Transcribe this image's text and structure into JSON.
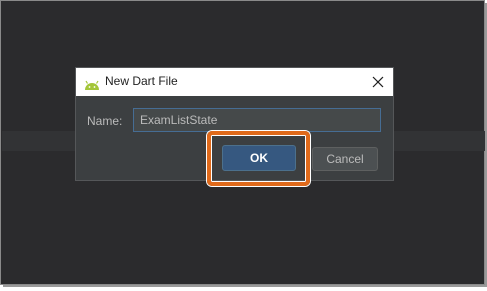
{
  "dialog": {
    "title": "New Dart File",
    "title_icon": "android-icon",
    "close_icon": "close-icon",
    "name_label": "Name:",
    "name_value": "ExamListState",
    "ok_label": "OK",
    "cancel_label": "Cancel"
  },
  "colors": {
    "background": "#2b2b2d",
    "dialog_body": "#3c3f41",
    "ok_button": "#365880",
    "highlight": "#e06a1b",
    "android_green": "#a4c639"
  }
}
